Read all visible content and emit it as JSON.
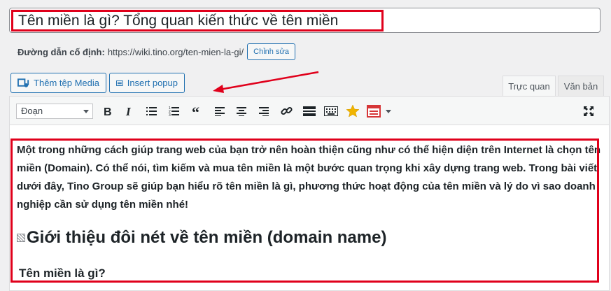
{
  "post": {
    "title": "Tên miền là gì? Tổng quan kiến thức về tên miền"
  },
  "permalink": {
    "label": "Đường dẫn cố định:",
    "url": "https://wiki.tino.org/ten-mien-la-gi/",
    "edit_button": "Chỉnh sửa"
  },
  "media": {
    "add_media": "Thêm tệp Media",
    "insert_popup": "Insert popup"
  },
  "tabs": {
    "visual": "Trực quan",
    "text": "Văn bản"
  },
  "toolbar": {
    "format_select": "Đoạn"
  },
  "content": {
    "paragraph": "Một trong những cách giúp trang web của bạn trở nên hoàn thiện cũng như có thể hiện diện trên Internet là chọn tên miền (Domain). Có thể nói, tìm kiếm và mua tên miền là một bước quan trọng khi xây dựng trang web. Trong bài viết dưới đây, Tino Group sẽ giúp bạn hiểu rõ tên miền là gì, phương thức hoạt động của tên miền và lý do vì sao doanh nghiệp cần sử dụng tên miền nhé!",
    "heading2": "Giới thiệu đôi nét về tên miền (domain name)",
    "heading3": "Tên miền là gì?"
  },
  "colors": {
    "accent": "#2271b1",
    "highlight": "#e0001b",
    "star": "#f0b400",
    "popup_icon": "#d63638"
  }
}
